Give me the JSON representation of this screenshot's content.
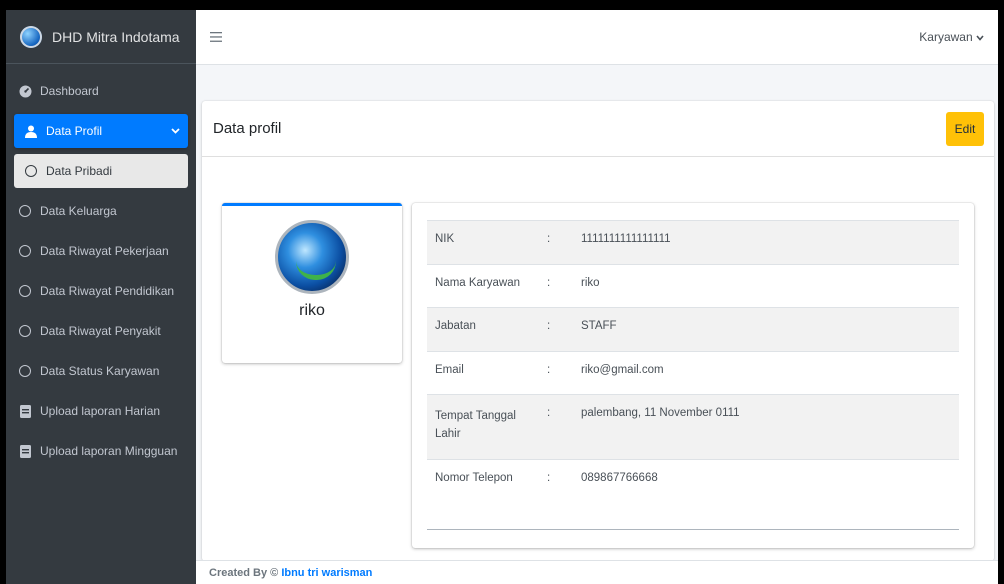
{
  "brand": {
    "name": "DHD Mitra Indotama",
    "logo": "globe-logo"
  },
  "topbar": {
    "menu_icon": "hamburger-icon",
    "user_label": "Karyawan",
    "user_chevron": "chevron-down-icon"
  },
  "sidebar": {
    "items": [
      {
        "label": "Dashboard",
        "icon": "tachometer-icon"
      },
      {
        "label": "Data Profil",
        "icon": "user-icon"
      },
      {
        "label": "Data Pribadi",
        "icon": "circle-icon"
      },
      {
        "label": "Data Keluarga",
        "icon": "circle-icon"
      },
      {
        "label": "Data Riwayat Pekerjaan",
        "icon": "circle-icon"
      },
      {
        "label": "Data Riwayat Pendidikan",
        "icon": "circle-icon"
      },
      {
        "label": "Data Riwayat Penyakit",
        "icon": "circle-icon"
      },
      {
        "label": "Data Status Karyawan",
        "icon": "circle-icon"
      },
      {
        "label": "Upload laporan Harian",
        "icon": "file-icon"
      },
      {
        "label": "Upload laporan Mingguan",
        "icon": "file-icon"
      }
    ]
  },
  "card": {
    "title": "Data profil",
    "edit_label": "Edit"
  },
  "profile": {
    "name": "riko"
  },
  "details": {
    "separator": ":",
    "rows": [
      {
        "label": "NIK",
        "value": "1111111111111111"
      },
      {
        "label": "Nama Karyawan",
        "value": "riko"
      },
      {
        "label": "Jabatan",
        "value": "STAFF"
      },
      {
        "label": "Email",
        "value": "riko@gmail.com"
      },
      {
        "label": "Tempat Tanggal Lahir",
        "value": "palembang, 11 November 0111"
      },
      {
        "label": "Nomor Telepon",
        "value": "089867766668"
      }
    ]
  },
  "footer": {
    "prefix": "Created By ©",
    "author": "Ibnu tri warisman"
  },
  "colors": {
    "sidebar": "#343a40",
    "primary": "#007bff",
    "warning": "#ffc107"
  }
}
